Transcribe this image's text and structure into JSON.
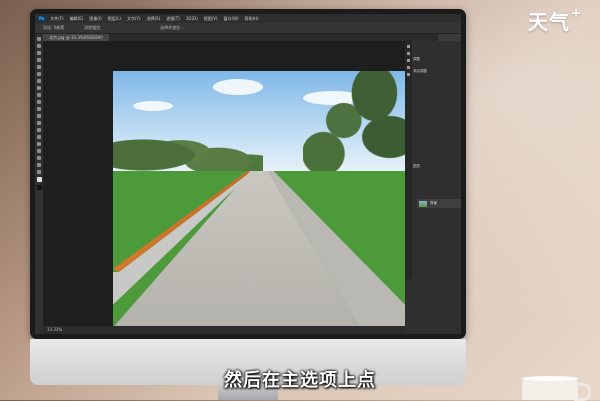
{
  "watermark": {
    "brand": "天气",
    "plus": "+"
  },
  "photoshop": {
    "app_badge": "Ps",
    "menu": [
      "文件(F)",
      "编辑(E)",
      "图像(I)",
      "图层(L)",
      "文字(Y)",
      "选择(S)",
      "滤镜(T)",
      "3D(D)",
      "视图(V)",
      "窗口(W)",
      "帮助(H)"
    ],
    "options": {
      "opt1": "羽化: 0像素",
      "opt2": "消除锯齿",
      "opt3": "选择并遮住..."
    },
    "doc_tab": "北京.jpg @ 33.3%(RGB/8#)",
    "panel": {
      "row1": "调整",
      "row2": "添加调整",
      "row3": "图层",
      "layer_name": "背景"
    },
    "status": "33.33%"
  },
  "subtitle": "然后在主选项上点"
}
